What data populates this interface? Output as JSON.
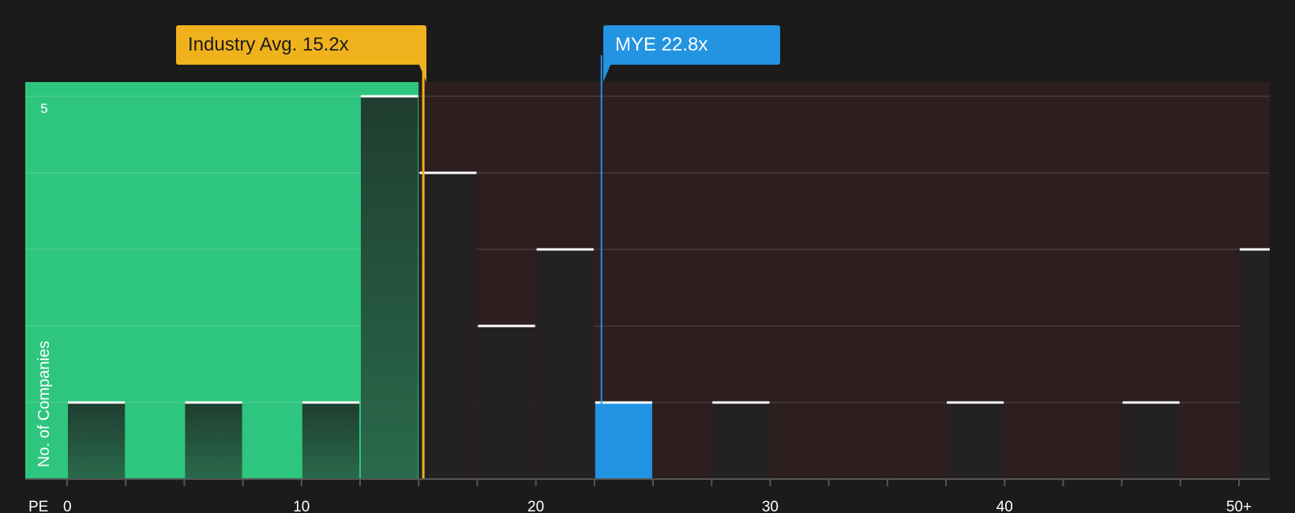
{
  "industry_label": "Industry Avg. 15.2x",
  "company_label": "MYE 22.8x",
  "axis": {
    "x_label": "PE",
    "y_label": "No. of Companies",
    "y_tick_label": "5"
  },
  "colors": {
    "background": "#1b1b1b",
    "below_avg_region": "#2ec67e",
    "above_avg_region": "#2d1e1f",
    "industry": "#efb21d",
    "company": "#2394e2",
    "bar_top": "#ffffff"
  },
  "chart_data": {
    "type": "bar",
    "title": "",
    "xlabel": "PE",
    "ylabel": "No. of Companies",
    "ylim": [
      0,
      5
    ],
    "xlim": [
      -2.5,
      51.3
    ],
    "x_ticks": [
      0,
      10,
      20,
      30,
      40,
      50
    ],
    "x_tick_labels": [
      "0",
      "10",
      "20",
      "30",
      "40",
      "50+"
    ],
    "bin_width": 2.5,
    "bins": [
      {
        "start": 0,
        "count": 1
      },
      {
        "start": 5,
        "count": 1
      },
      {
        "start": 10,
        "count": 1
      },
      {
        "start": 12.5,
        "count": 5
      },
      {
        "start": 15,
        "count": 4
      },
      {
        "start": 17.5,
        "count": 2
      },
      {
        "start": 20,
        "count": 3
      },
      {
        "start": 22.5,
        "count": 1,
        "highlight": true
      },
      {
        "start": 27.5,
        "count": 1
      },
      {
        "start": 37.5,
        "count": 1
      },
      {
        "start": 45,
        "count": 1
      },
      {
        "start": 50,
        "count": 3
      }
    ],
    "industry_avg": 15.2,
    "company_value": 22.8,
    "company_name": "MYE"
  }
}
